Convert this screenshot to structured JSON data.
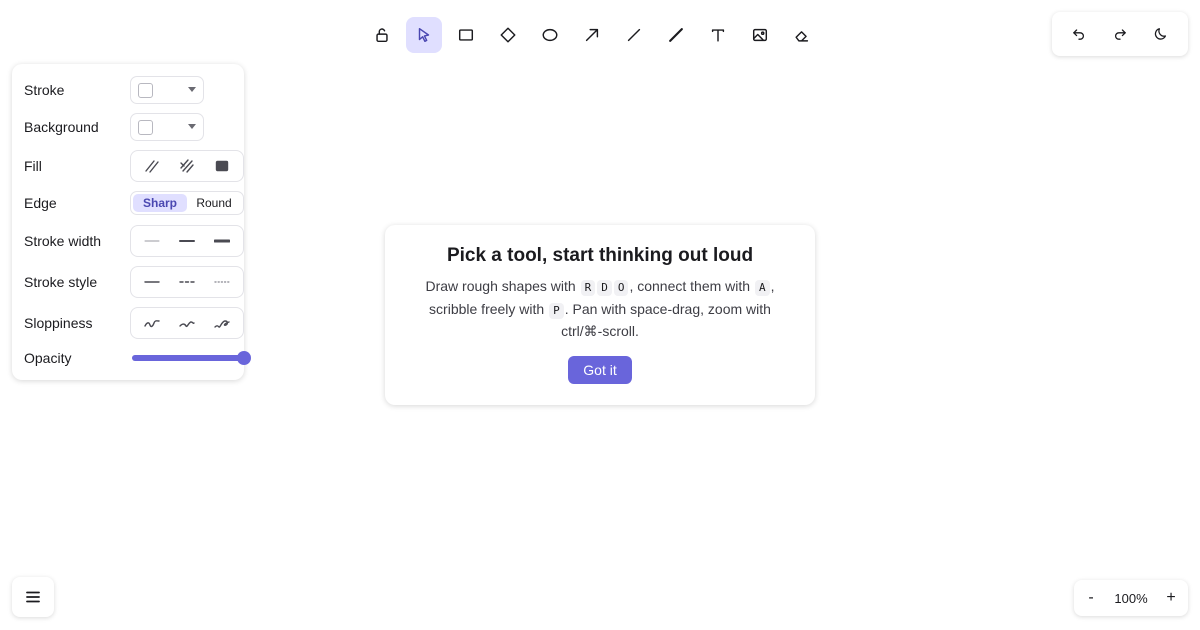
{
  "toolbar": {
    "tools": [
      {
        "name": "lock-icon"
      },
      {
        "name": "selection-icon",
        "active": true
      },
      {
        "name": "rectangle-icon"
      },
      {
        "name": "diamond-icon"
      },
      {
        "name": "ellipse-icon"
      },
      {
        "name": "arrow-icon"
      },
      {
        "name": "line-icon"
      },
      {
        "name": "draw-icon"
      },
      {
        "name": "text-icon"
      },
      {
        "name": "image-icon"
      },
      {
        "name": "eraser-icon"
      }
    ]
  },
  "top_right": {
    "icons": [
      "undo-icon",
      "redo-icon",
      "moon-icon"
    ]
  },
  "properties": {
    "stroke_label": "Stroke",
    "background_label": "Background",
    "fill_label": "Fill",
    "edge_label": "Edge",
    "edge_sharp": "Sharp",
    "edge_round": "Round",
    "edge_selected": "Sharp",
    "stroke_width_label": "Stroke width",
    "stroke_style_label": "Stroke style",
    "sloppiness_label": "Sloppiness",
    "opacity_label": "Opacity",
    "opacity_value": 100
  },
  "welcome": {
    "title": "Pick a tool, start thinking out loud",
    "line1_prefix": "Draw rough shapes with",
    "key_r": "R",
    "key_d": "D",
    "key_o": "O",
    "line1_mid": ", connect them with",
    "key_a": "A",
    "line1_suffix": ",",
    "line2_prefix": "scribble freely with",
    "key_p": "P",
    "line2_suffix": ". Pan with space-drag, zoom with",
    "line3": "ctrl/⌘-scroll.",
    "button": "Got it"
  },
  "zoom": {
    "minus": "-",
    "value": "100%",
    "plus": "+"
  },
  "colors": {
    "accent": "#6965db",
    "accent_soft": "#e0dfff"
  }
}
